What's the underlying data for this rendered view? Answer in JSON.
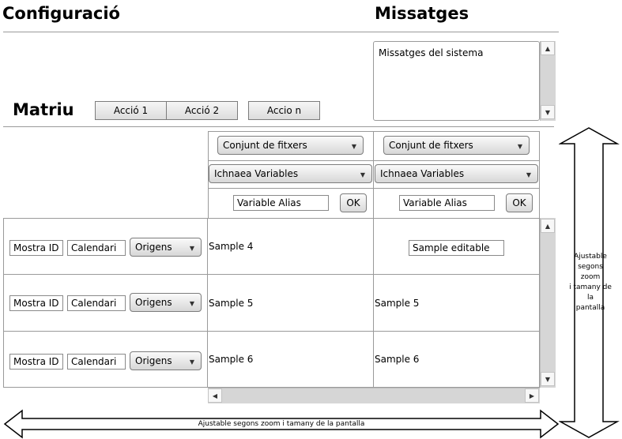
{
  "header": {
    "config_title": "Configuració",
    "messages_title": "Missatges"
  },
  "messages": {
    "content": "Missatges del sistema"
  },
  "matrix": {
    "title": "Matriu",
    "actions": [
      "Acció 1",
      "Acció 2",
      "Accio n"
    ]
  },
  "columns": [
    {
      "fileset_select": "Conjunt de fitxers",
      "variables_select": "Ichnaea Variables",
      "alias_value": "Variable Alias",
      "ok_label": "OK"
    },
    {
      "fileset_select": "Conjunt de fitxers",
      "variables_select": "Ichnaea Variables",
      "alias_value": "Variable Alias",
      "ok_label": "OK"
    }
  ],
  "rows": [
    {
      "id": "Mostra ID",
      "calendar": "Calendari",
      "origins": "Origens",
      "col1": "Sample 4",
      "col2": "Sample editable"
    },
    {
      "id": "Mostra ID",
      "calendar": "Calendari",
      "origins": "Origens",
      "col1": "Sample 5",
      "col2": "Sample 5"
    },
    {
      "id": "Mostra ID",
      "calendar": "Calendari",
      "origins": "Origens",
      "col1": "Sample 6",
      "col2": "Sample 6"
    }
  ],
  "notes": {
    "vertical": "Ajustable\nsegons\nzoom\ni tamany de\nla\npantalla",
    "horizontal": "Ajustable segons zoom i tamany de la pantalla"
  }
}
